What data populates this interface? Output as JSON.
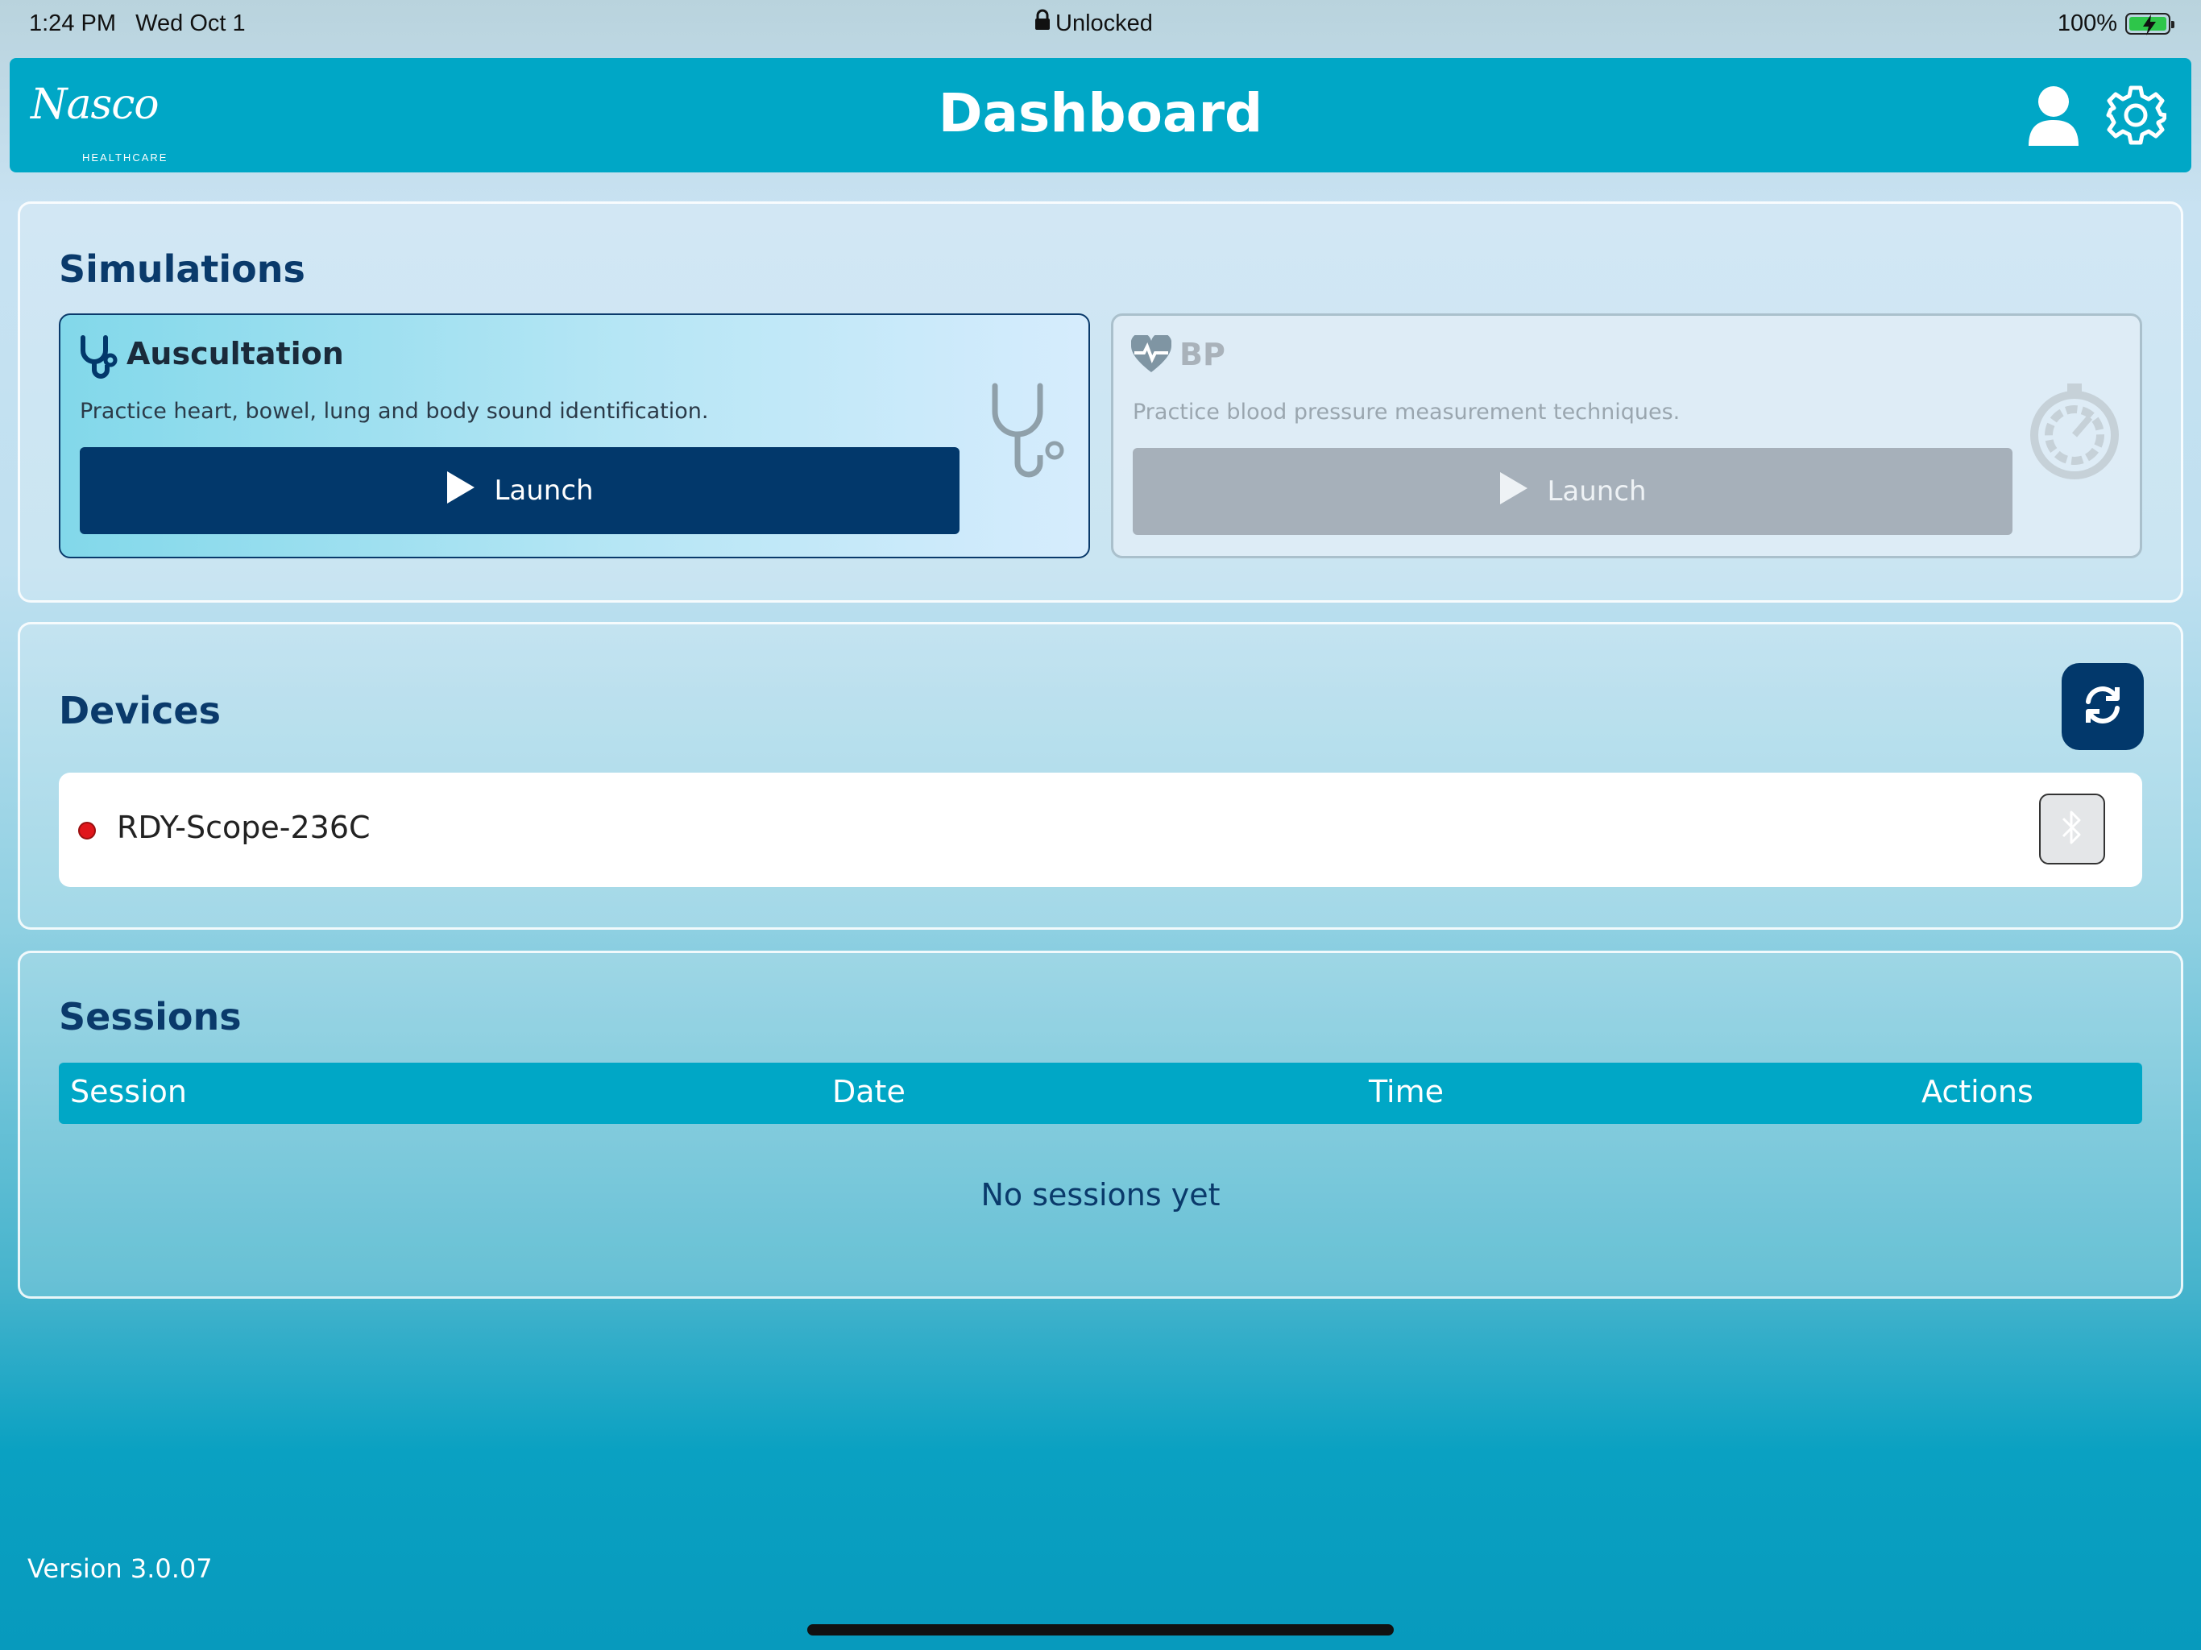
{
  "status_bar": {
    "time": "1:24 PM",
    "date": "Wed Oct 1",
    "lock_label": "Unlocked",
    "battery_percent": "100%",
    "battery_level": 1.0,
    "icons": [
      "lock-icon",
      "battery-charging-icon"
    ]
  },
  "header": {
    "logo_script": "Nasco",
    "logo_sub": "HEALTHCARE",
    "title": "Dashboard",
    "icons": [
      "user-icon",
      "gear-icon"
    ],
    "color": "#00a7c6"
  },
  "simulations": {
    "title": "Simulations",
    "cards": [
      {
        "title": "Auscultation",
        "description": "Practice heart, bowel, lung and body sound identification.",
        "button_label": "Launch",
        "state": "enabled",
        "icon": "stethoscope-icon"
      },
      {
        "title": "BP",
        "description": "Practice blood pressure measurement techniques.",
        "button_label": "Launch",
        "state": "disabled",
        "icon": "heart-pulse-icon"
      }
    ]
  },
  "devices": {
    "title": "Devices",
    "refresh_icon": "refresh-icon",
    "items": [
      {
        "name": "RDY-Scope-236C",
        "status_color": "#e0161b",
        "action_icon": "bluetooth-icon"
      }
    ]
  },
  "sessions": {
    "title": "Sessions",
    "columns": [
      "Session",
      "Date",
      "Time",
      "Actions"
    ],
    "empty_message": "No sessions yet"
  },
  "footer": {
    "version": "Version 3.0.07"
  },
  "colors": {
    "primary_dark": "#02386b",
    "accent": "#00a7c6",
    "disabled": "#a6b0ba"
  }
}
